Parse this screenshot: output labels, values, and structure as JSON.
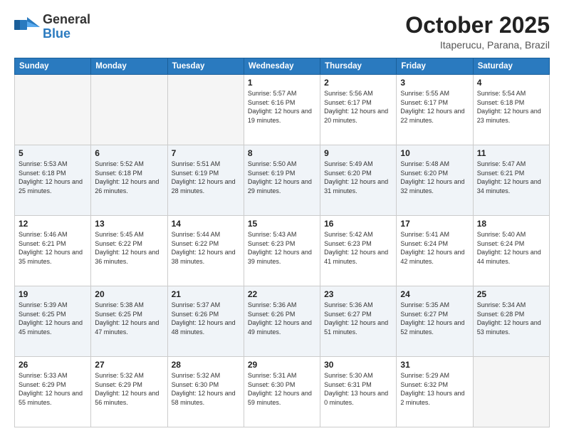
{
  "header": {
    "logo_general": "General",
    "logo_blue": "Blue",
    "month_title": "October 2025",
    "location": "Itaperucu, Parana, Brazil"
  },
  "days_of_week": [
    "Sunday",
    "Monday",
    "Tuesday",
    "Wednesday",
    "Thursday",
    "Friday",
    "Saturday"
  ],
  "weeks": [
    {
      "shaded": false,
      "days": [
        {
          "num": "",
          "empty": true,
          "sunrise": "",
          "sunset": "",
          "daylight": ""
        },
        {
          "num": "",
          "empty": true,
          "sunrise": "",
          "sunset": "",
          "daylight": ""
        },
        {
          "num": "",
          "empty": true,
          "sunrise": "",
          "sunset": "",
          "daylight": ""
        },
        {
          "num": "1",
          "empty": false,
          "sunrise": "Sunrise: 5:57 AM",
          "sunset": "Sunset: 6:16 PM",
          "daylight": "Daylight: 12 hours and 19 minutes."
        },
        {
          "num": "2",
          "empty": false,
          "sunrise": "Sunrise: 5:56 AM",
          "sunset": "Sunset: 6:17 PM",
          "daylight": "Daylight: 12 hours and 20 minutes."
        },
        {
          "num": "3",
          "empty": false,
          "sunrise": "Sunrise: 5:55 AM",
          "sunset": "Sunset: 6:17 PM",
          "daylight": "Daylight: 12 hours and 22 minutes."
        },
        {
          "num": "4",
          "empty": false,
          "sunrise": "Sunrise: 5:54 AM",
          "sunset": "Sunset: 6:18 PM",
          "daylight": "Daylight: 12 hours and 23 minutes."
        }
      ]
    },
    {
      "shaded": true,
      "days": [
        {
          "num": "5",
          "empty": false,
          "sunrise": "Sunrise: 5:53 AM",
          "sunset": "Sunset: 6:18 PM",
          "daylight": "Daylight: 12 hours and 25 minutes."
        },
        {
          "num": "6",
          "empty": false,
          "sunrise": "Sunrise: 5:52 AM",
          "sunset": "Sunset: 6:18 PM",
          "daylight": "Daylight: 12 hours and 26 minutes."
        },
        {
          "num": "7",
          "empty": false,
          "sunrise": "Sunrise: 5:51 AM",
          "sunset": "Sunset: 6:19 PM",
          "daylight": "Daylight: 12 hours and 28 minutes."
        },
        {
          "num": "8",
          "empty": false,
          "sunrise": "Sunrise: 5:50 AM",
          "sunset": "Sunset: 6:19 PM",
          "daylight": "Daylight: 12 hours and 29 minutes."
        },
        {
          "num": "9",
          "empty": false,
          "sunrise": "Sunrise: 5:49 AM",
          "sunset": "Sunset: 6:20 PM",
          "daylight": "Daylight: 12 hours and 31 minutes."
        },
        {
          "num": "10",
          "empty": false,
          "sunrise": "Sunrise: 5:48 AM",
          "sunset": "Sunset: 6:20 PM",
          "daylight": "Daylight: 12 hours and 32 minutes."
        },
        {
          "num": "11",
          "empty": false,
          "sunrise": "Sunrise: 5:47 AM",
          "sunset": "Sunset: 6:21 PM",
          "daylight": "Daylight: 12 hours and 34 minutes."
        }
      ]
    },
    {
      "shaded": false,
      "days": [
        {
          "num": "12",
          "empty": false,
          "sunrise": "Sunrise: 5:46 AM",
          "sunset": "Sunset: 6:21 PM",
          "daylight": "Daylight: 12 hours and 35 minutes."
        },
        {
          "num": "13",
          "empty": false,
          "sunrise": "Sunrise: 5:45 AM",
          "sunset": "Sunset: 6:22 PM",
          "daylight": "Daylight: 12 hours and 36 minutes."
        },
        {
          "num": "14",
          "empty": false,
          "sunrise": "Sunrise: 5:44 AM",
          "sunset": "Sunset: 6:22 PM",
          "daylight": "Daylight: 12 hours and 38 minutes."
        },
        {
          "num": "15",
          "empty": false,
          "sunrise": "Sunrise: 5:43 AM",
          "sunset": "Sunset: 6:23 PM",
          "daylight": "Daylight: 12 hours and 39 minutes."
        },
        {
          "num": "16",
          "empty": false,
          "sunrise": "Sunrise: 5:42 AM",
          "sunset": "Sunset: 6:23 PM",
          "daylight": "Daylight: 12 hours and 41 minutes."
        },
        {
          "num": "17",
          "empty": false,
          "sunrise": "Sunrise: 5:41 AM",
          "sunset": "Sunset: 6:24 PM",
          "daylight": "Daylight: 12 hours and 42 minutes."
        },
        {
          "num": "18",
          "empty": false,
          "sunrise": "Sunrise: 5:40 AM",
          "sunset": "Sunset: 6:24 PM",
          "daylight": "Daylight: 12 hours and 44 minutes."
        }
      ]
    },
    {
      "shaded": true,
      "days": [
        {
          "num": "19",
          "empty": false,
          "sunrise": "Sunrise: 5:39 AM",
          "sunset": "Sunset: 6:25 PM",
          "daylight": "Daylight: 12 hours and 45 minutes."
        },
        {
          "num": "20",
          "empty": false,
          "sunrise": "Sunrise: 5:38 AM",
          "sunset": "Sunset: 6:25 PM",
          "daylight": "Daylight: 12 hours and 47 minutes."
        },
        {
          "num": "21",
          "empty": false,
          "sunrise": "Sunrise: 5:37 AM",
          "sunset": "Sunset: 6:26 PM",
          "daylight": "Daylight: 12 hours and 48 minutes."
        },
        {
          "num": "22",
          "empty": false,
          "sunrise": "Sunrise: 5:36 AM",
          "sunset": "Sunset: 6:26 PM",
          "daylight": "Daylight: 12 hours and 49 minutes."
        },
        {
          "num": "23",
          "empty": false,
          "sunrise": "Sunrise: 5:36 AM",
          "sunset": "Sunset: 6:27 PM",
          "daylight": "Daylight: 12 hours and 51 minutes."
        },
        {
          "num": "24",
          "empty": false,
          "sunrise": "Sunrise: 5:35 AM",
          "sunset": "Sunset: 6:27 PM",
          "daylight": "Daylight: 12 hours and 52 minutes."
        },
        {
          "num": "25",
          "empty": false,
          "sunrise": "Sunrise: 5:34 AM",
          "sunset": "Sunset: 6:28 PM",
          "daylight": "Daylight: 12 hours and 53 minutes."
        }
      ]
    },
    {
      "shaded": false,
      "days": [
        {
          "num": "26",
          "empty": false,
          "sunrise": "Sunrise: 5:33 AM",
          "sunset": "Sunset: 6:29 PM",
          "daylight": "Daylight: 12 hours and 55 minutes."
        },
        {
          "num": "27",
          "empty": false,
          "sunrise": "Sunrise: 5:32 AM",
          "sunset": "Sunset: 6:29 PM",
          "daylight": "Daylight: 12 hours and 56 minutes."
        },
        {
          "num": "28",
          "empty": false,
          "sunrise": "Sunrise: 5:32 AM",
          "sunset": "Sunset: 6:30 PM",
          "daylight": "Daylight: 12 hours and 58 minutes."
        },
        {
          "num": "29",
          "empty": false,
          "sunrise": "Sunrise: 5:31 AM",
          "sunset": "Sunset: 6:30 PM",
          "daylight": "Daylight: 12 hours and 59 minutes."
        },
        {
          "num": "30",
          "empty": false,
          "sunrise": "Sunrise: 5:30 AM",
          "sunset": "Sunset: 6:31 PM",
          "daylight": "Daylight: 13 hours and 0 minutes."
        },
        {
          "num": "31",
          "empty": false,
          "sunrise": "Sunrise: 5:29 AM",
          "sunset": "Sunset: 6:32 PM",
          "daylight": "Daylight: 13 hours and 2 minutes."
        },
        {
          "num": "",
          "empty": true,
          "sunrise": "",
          "sunset": "",
          "daylight": ""
        }
      ]
    }
  ]
}
